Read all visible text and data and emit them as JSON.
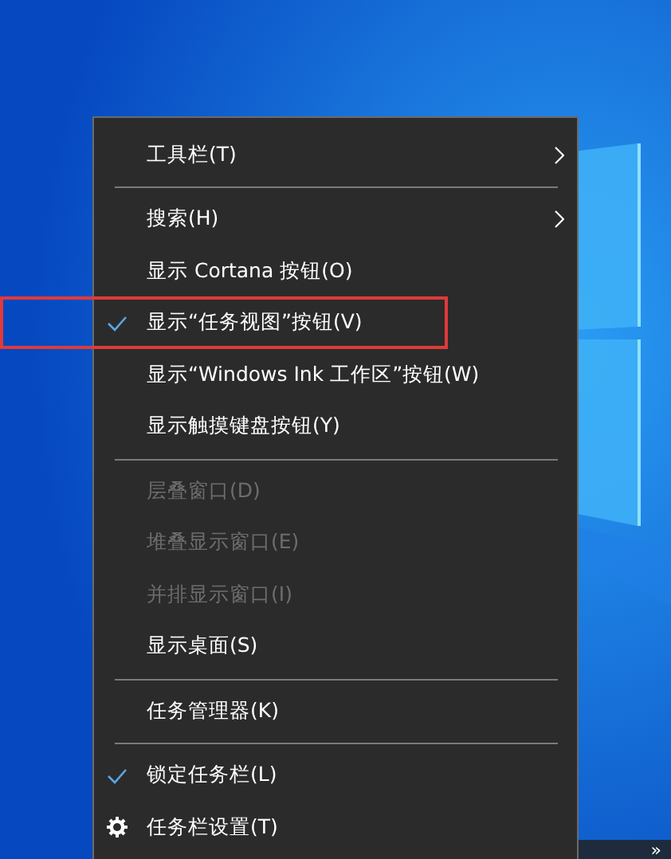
{
  "menu": {
    "items": [
      {
        "kind": "item",
        "label": "工具栏(T)",
        "checked": false,
        "disabled": false,
        "submenu": true,
        "highlighted": false
      },
      {
        "kind": "separator"
      },
      {
        "kind": "item",
        "label": "搜索(H)",
        "checked": false,
        "disabled": false,
        "submenu": true,
        "highlighted": false
      },
      {
        "kind": "item",
        "label": "显示 Cortana 按钮(O)",
        "checked": false,
        "disabled": false,
        "submenu": false,
        "highlighted": false
      },
      {
        "kind": "item",
        "label": "显示“任务视图”按钮(V)",
        "checked": true,
        "disabled": false,
        "submenu": false,
        "highlighted": true
      },
      {
        "kind": "item",
        "label": "显示“Windows Ink 工作区”按钮(W)",
        "checked": false,
        "disabled": false,
        "submenu": false,
        "highlighted": false
      },
      {
        "kind": "item",
        "label": "显示触摸键盘按钮(Y)",
        "checked": false,
        "disabled": false,
        "submenu": false,
        "highlighted": false
      },
      {
        "kind": "separator"
      },
      {
        "kind": "item",
        "label": "层叠窗口(D)",
        "checked": false,
        "disabled": true,
        "submenu": false,
        "highlighted": false
      },
      {
        "kind": "item",
        "label": "堆叠显示窗口(E)",
        "checked": false,
        "disabled": true,
        "submenu": false,
        "highlighted": false
      },
      {
        "kind": "item",
        "label": "并排显示窗口(I)",
        "checked": false,
        "disabled": true,
        "submenu": false,
        "highlighted": false
      },
      {
        "kind": "item",
        "label": "显示桌面(S)",
        "checked": false,
        "disabled": false,
        "submenu": false,
        "highlighted": false
      },
      {
        "kind": "separator"
      },
      {
        "kind": "item",
        "label": "任务管理器(K)",
        "checked": false,
        "disabled": false,
        "submenu": false,
        "highlighted": false
      },
      {
        "kind": "separator"
      },
      {
        "kind": "item",
        "label": "锁定任务栏(L)",
        "checked": true,
        "disabled": false,
        "submenu": false,
        "highlighted": false
      },
      {
        "kind": "settings",
        "label": "任务栏设置(T)",
        "checked": false,
        "disabled": false,
        "submenu": false,
        "highlighted": false
      }
    ]
  },
  "taskbar": {
    "overflow": "»"
  }
}
